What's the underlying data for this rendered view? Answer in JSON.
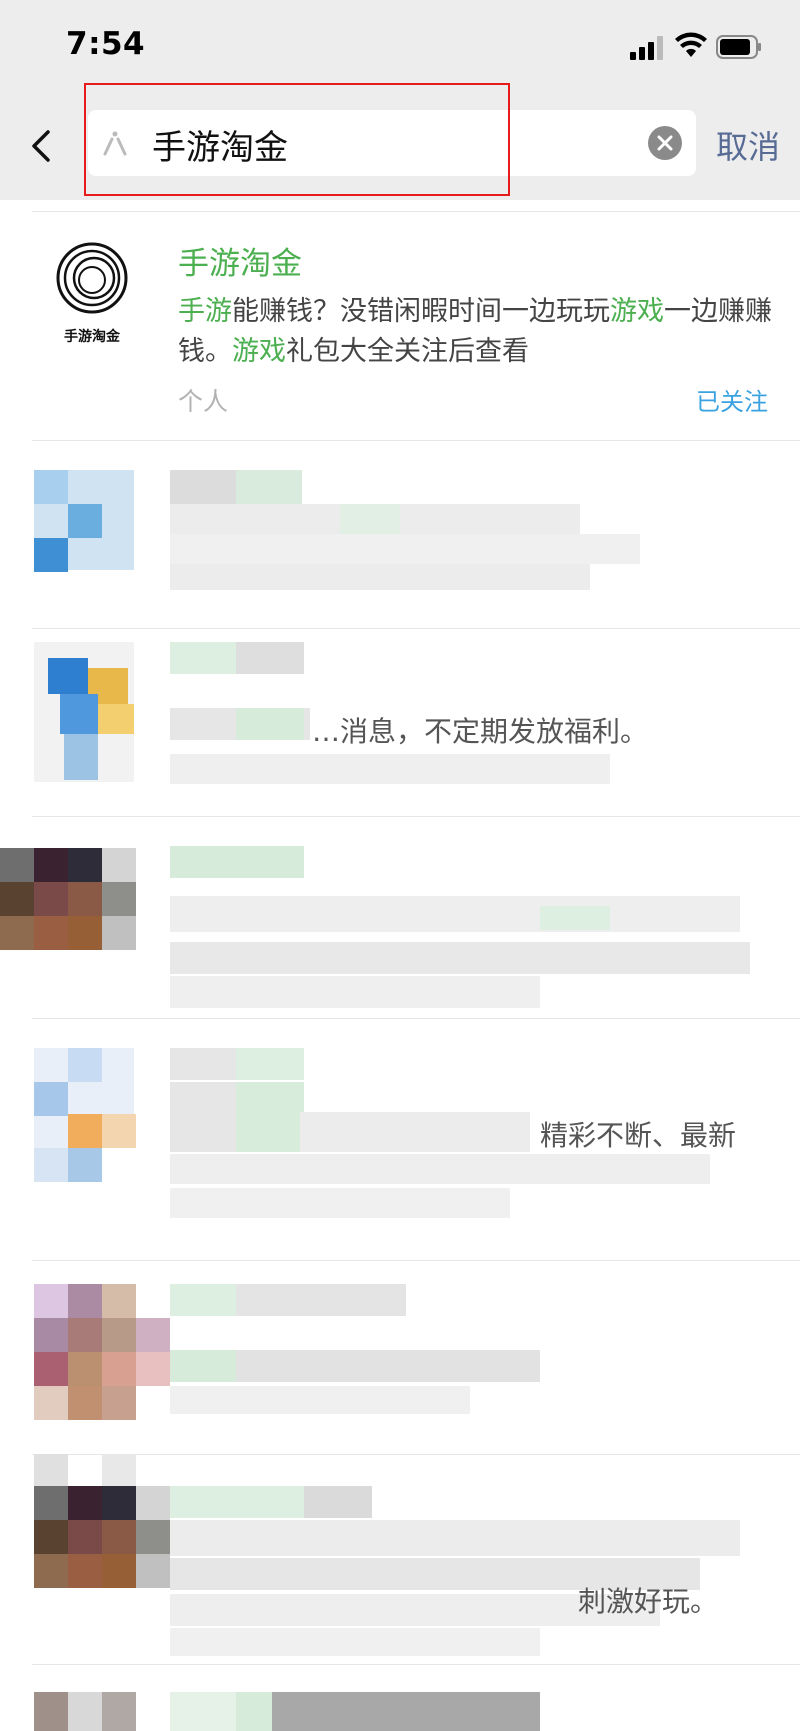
{
  "status_bar": {
    "time": "7:54"
  },
  "search": {
    "query": "手游淘金",
    "cancel_label": "取消"
  },
  "result": {
    "name": "手游淘金",
    "logo_text": "手游淘金",
    "desc_parts": [
      {
        "text": "手游",
        "highlight": true
      },
      {
        "text": "能赚钱？没错闲暇时间一边玩玩",
        "highlight": false
      },
      {
        "text": "游戏",
        "highlight": true
      },
      {
        "text": "一边赚赚钱。",
        "highlight": false
      },
      {
        "text": "游戏",
        "highlight": true
      },
      {
        "text": "礼包大全关注后查看",
        "highlight": false
      }
    ],
    "type": "个人",
    "follow_status": "已关注"
  },
  "blurred_rows": [
    {
      "fragment": ""
    },
    {
      "fragment": "福利。",
      "visible_fragment": "…消息，不定期发放福利。"
    },
    {
      "fragment": ""
    },
    {
      "fragment": "精彩不断、最新"
    },
    {
      "fragment": ""
    },
    {
      "fragment": "刺激好玩。"
    }
  ],
  "colors": {
    "accent_green": "#4caf50",
    "link_blue": "#576b95",
    "follow_blue": "#3aa2e0",
    "highlight_red": "#e61c1c"
  }
}
